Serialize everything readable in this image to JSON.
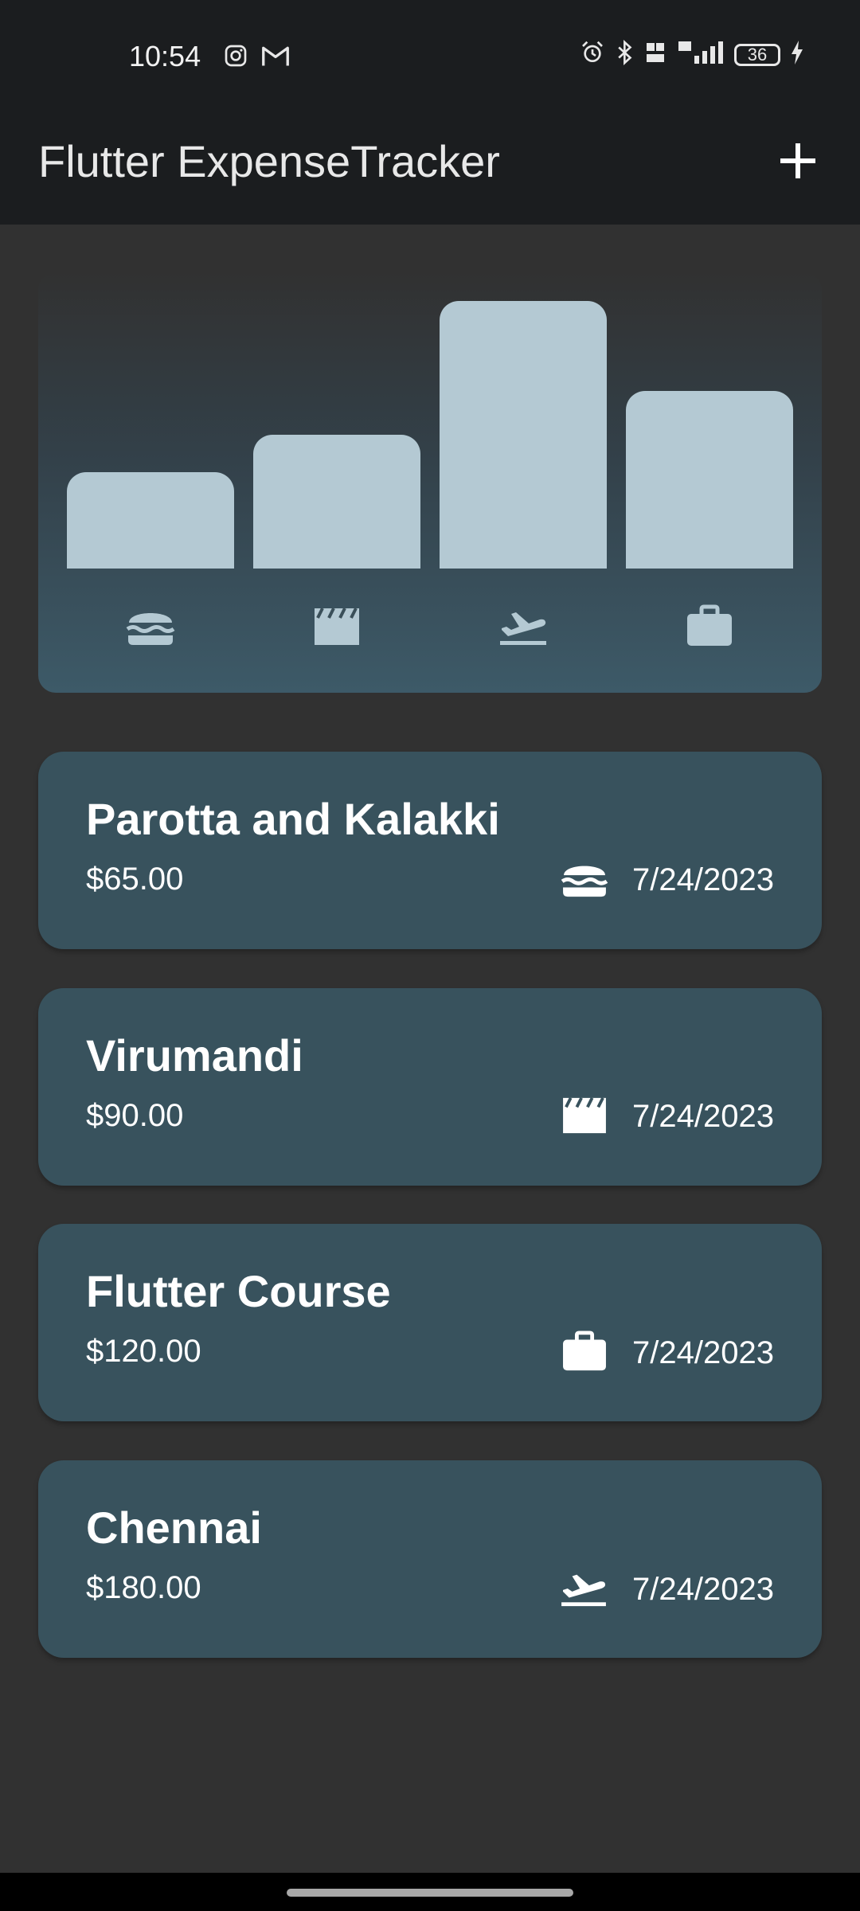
{
  "status_bar": {
    "time": "10:54",
    "notifications": [
      "instagram-icon",
      "gmail-icon"
    ],
    "right_icons": [
      "alarm-icon",
      "bluetooth-icon",
      "volte-icon",
      "5g-signal-icon"
    ],
    "battery": "36"
  },
  "app_bar": {
    "title": "Flutter ExpenseTracker",
    "add_icon": "plus-icon"
  },
  "chart": {
    "bar_color": "#b4c9d3",
    "buckets": [
      {
        "category": "food",
        "icon": "burger-icon",
        "fill": 0.36
      },
      {
        "category": "leisure",
        "icon": "movie-clapper-icon",
        "fill": 0.5
      },
      {
        "category": "travel",
        "icon": "flight-takeoff-icon",
        "fill": 1.0
      },
      {
        "category": "work",
        "icon": "briefcase-icon",
        "fill": 0.665
      }
    ]
  },
  "expenses": [
    {
      "title": "Parotta and Kalakki",
      "amount": "$65.00",
      "icon": "burger-icon",
      "date": "7/24/2023"
    },
    {
      "title": "Virumandi",
      "amount": "$90.00",
      "icon": "movie-clapper-icon",
      "date": "7/24/2023"
    },
    {
      "title": "Flutter Course",
      "amount": "$120.00",
      "icon": "briefcase-icon",
      "date": "7/24/2023"
    },
    {
      "title": "Chennai",
      "amount": "$180.00",
      "icon": "flight-takeoff-icon",
      "date": "7/24/2023"
    }
  ]
}
